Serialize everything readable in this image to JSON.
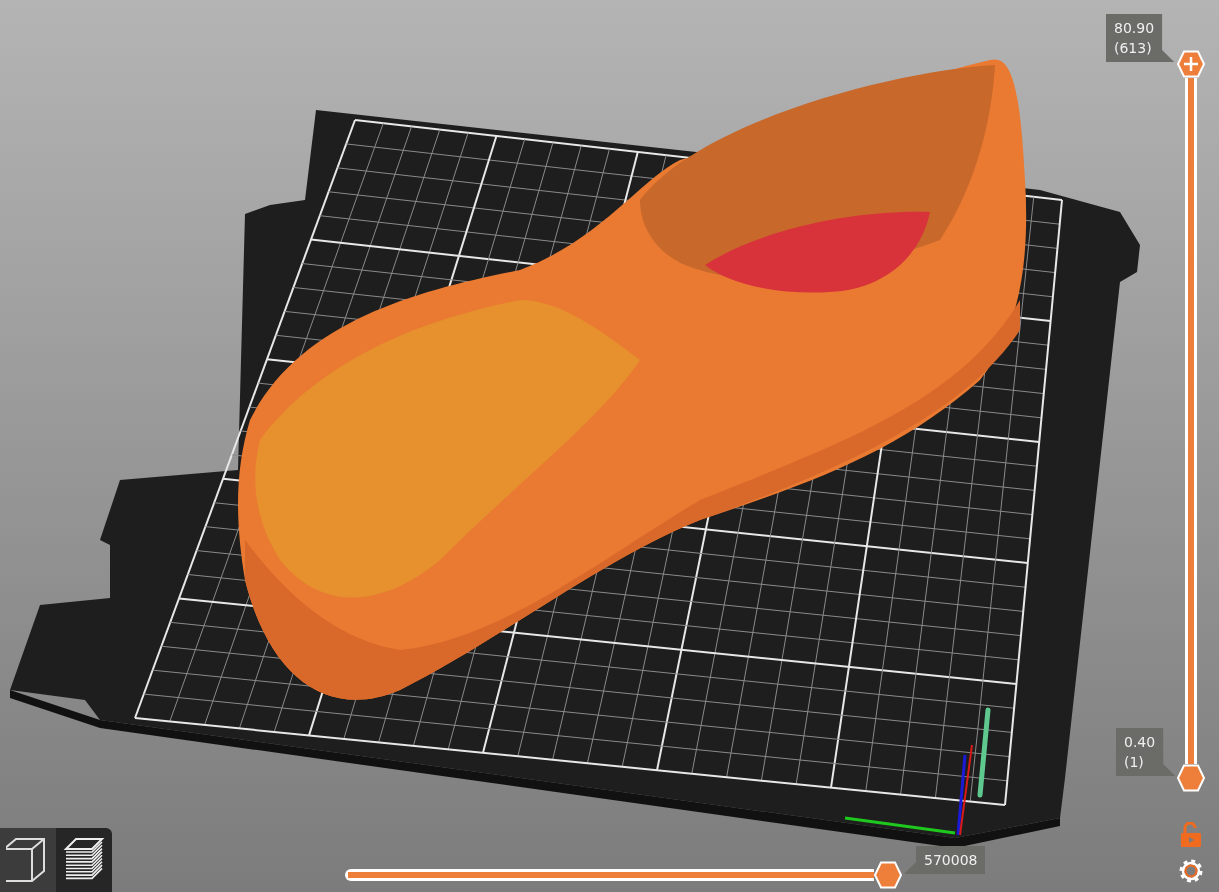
{
  "vertical_slider": {
    "upper": {
      "value": "80.90",
      "layer": "(613)",
      "level": 1
    },
    "lower": {
      "value": "0.40",
      "layer": "(1)",
      "level": 0
    }
  },
  "horizontal_slider": {
    "value": "570008",
    "level": 1
  },
  "view_buttons": [
    {
      "kind": "solid",
      "selected": false
    },
    {
      "kind": "layers",
      "selected": true
    }
  ]
}
